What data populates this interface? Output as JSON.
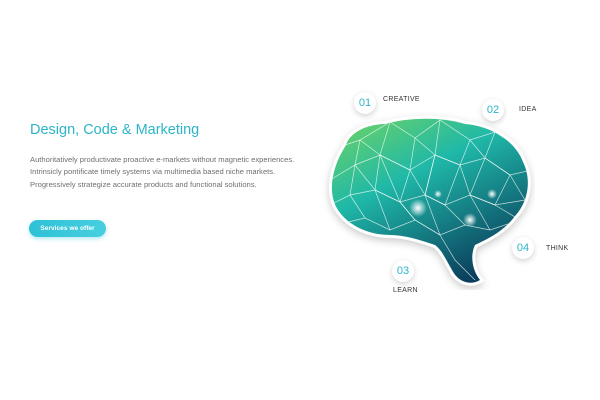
{
  "hero": {
    "title": "Design, Code & Marketing",
    "description": "Authoritatively productivate proactive e-markets without magnetic experiences. Intrinsicly pontificate timely systems via multimedia based niche markets. Progressively strategize accurate products and functional solutions.",
    "cta_label": "Services we offer"
  },
  "steps": [
    {
      "number": "01",
      "label": "CREATIVE"
    },
    {
      "number": "02",
      "label": "IDEA"
    },
    {
      "number": "03",
      "label": "LEARN"
    },
    {
      "number": "04",
      "label": "THINK"
    }
  ],
  "colors": {
    "accent": "#2cb5c9",
    "brain_top": "#7ed957",
    "brain_mid": "#1fb8a8",
    "brain_bottom": "#0a3e5c"
  }
}
